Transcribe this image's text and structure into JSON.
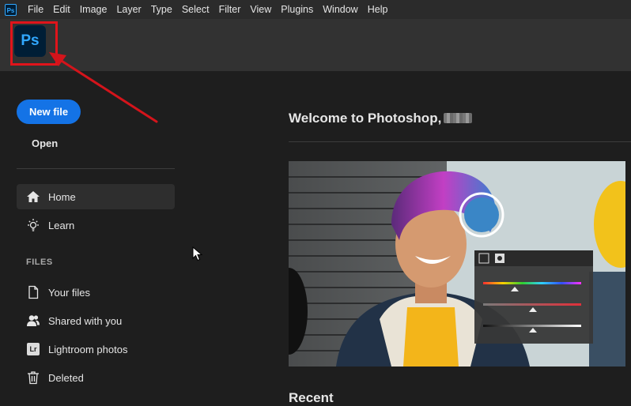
{
  "menubar": {
    "app_icon_text": "Ps",
    "items": [
      "File",
      "Edit",
      "Image",
      "Layer",
      "Type",
      "Select",
      "Filter",
      "View",
      "Plugins",
      "Window",
      "Help"
    ]
  },
  "header": {
    "logo_text": "Ps"
  },
  "sidebar": {
    "new_file_label": "New file",
    "open_label": "Open",
    "nav": [
      {
        "label": "Home",
        "icon": "home-icon",
        "active": true
      },
      {
        "label": "Learn",
        "icon": "lightbulb-icon",
        "active": false
      }
    ],
    "files_heading": "FILES",
    "files": [
      {
        "label": "Your files",
        "icon": "document-icon"
      },
      {
        "label": "Shared with you",
        "icon": "people-icon"
      },
      {
        "label": "Lightroom photos",
        "icon": "lightroom-icon",
        "badge": "Lr"
      },
      {
        "label": "Deleted",
        "icon": "trash-icon"
      }
    ]
  },
  "main": {
    "welcome": "Welcome to Photoshop,",
    "recent_heading": "Recent"
  },
  "colors": {
    "accent": "#1473e6",
    "ps_blue": "#31a8ff",
    "highlight_red": "#e0141b",
    "background": "#1e1e1e"
  }
}
